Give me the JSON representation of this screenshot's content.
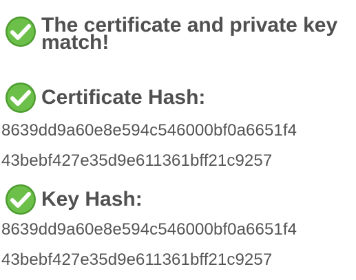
{
  "result": {
    "match_message": "The certificate and private key match!"
  },
  "certificate_hash": {
    "label": "Certificate Hash:",
    "lines": [
      "8639dd9a60e8e594c546000bf0a6651f4",
      "43bebf427e35d9e611361bff21c9257"
    ]
  },
  "key_hash": {
    "label": "Key Hash:",
    "lines": [
      "8639dd9a60e8e594c546000bf0a6651f4",
      "43bebf427e35d9e611361bff21c9257"
    ]
  },
  "colors": {
    "check_green": "#6cc04a",
    "check_green_dark": "#4e9d30",
    "text": "#505050"
  },
  "icons": [
    "check-circle-icon"
  ]
}
